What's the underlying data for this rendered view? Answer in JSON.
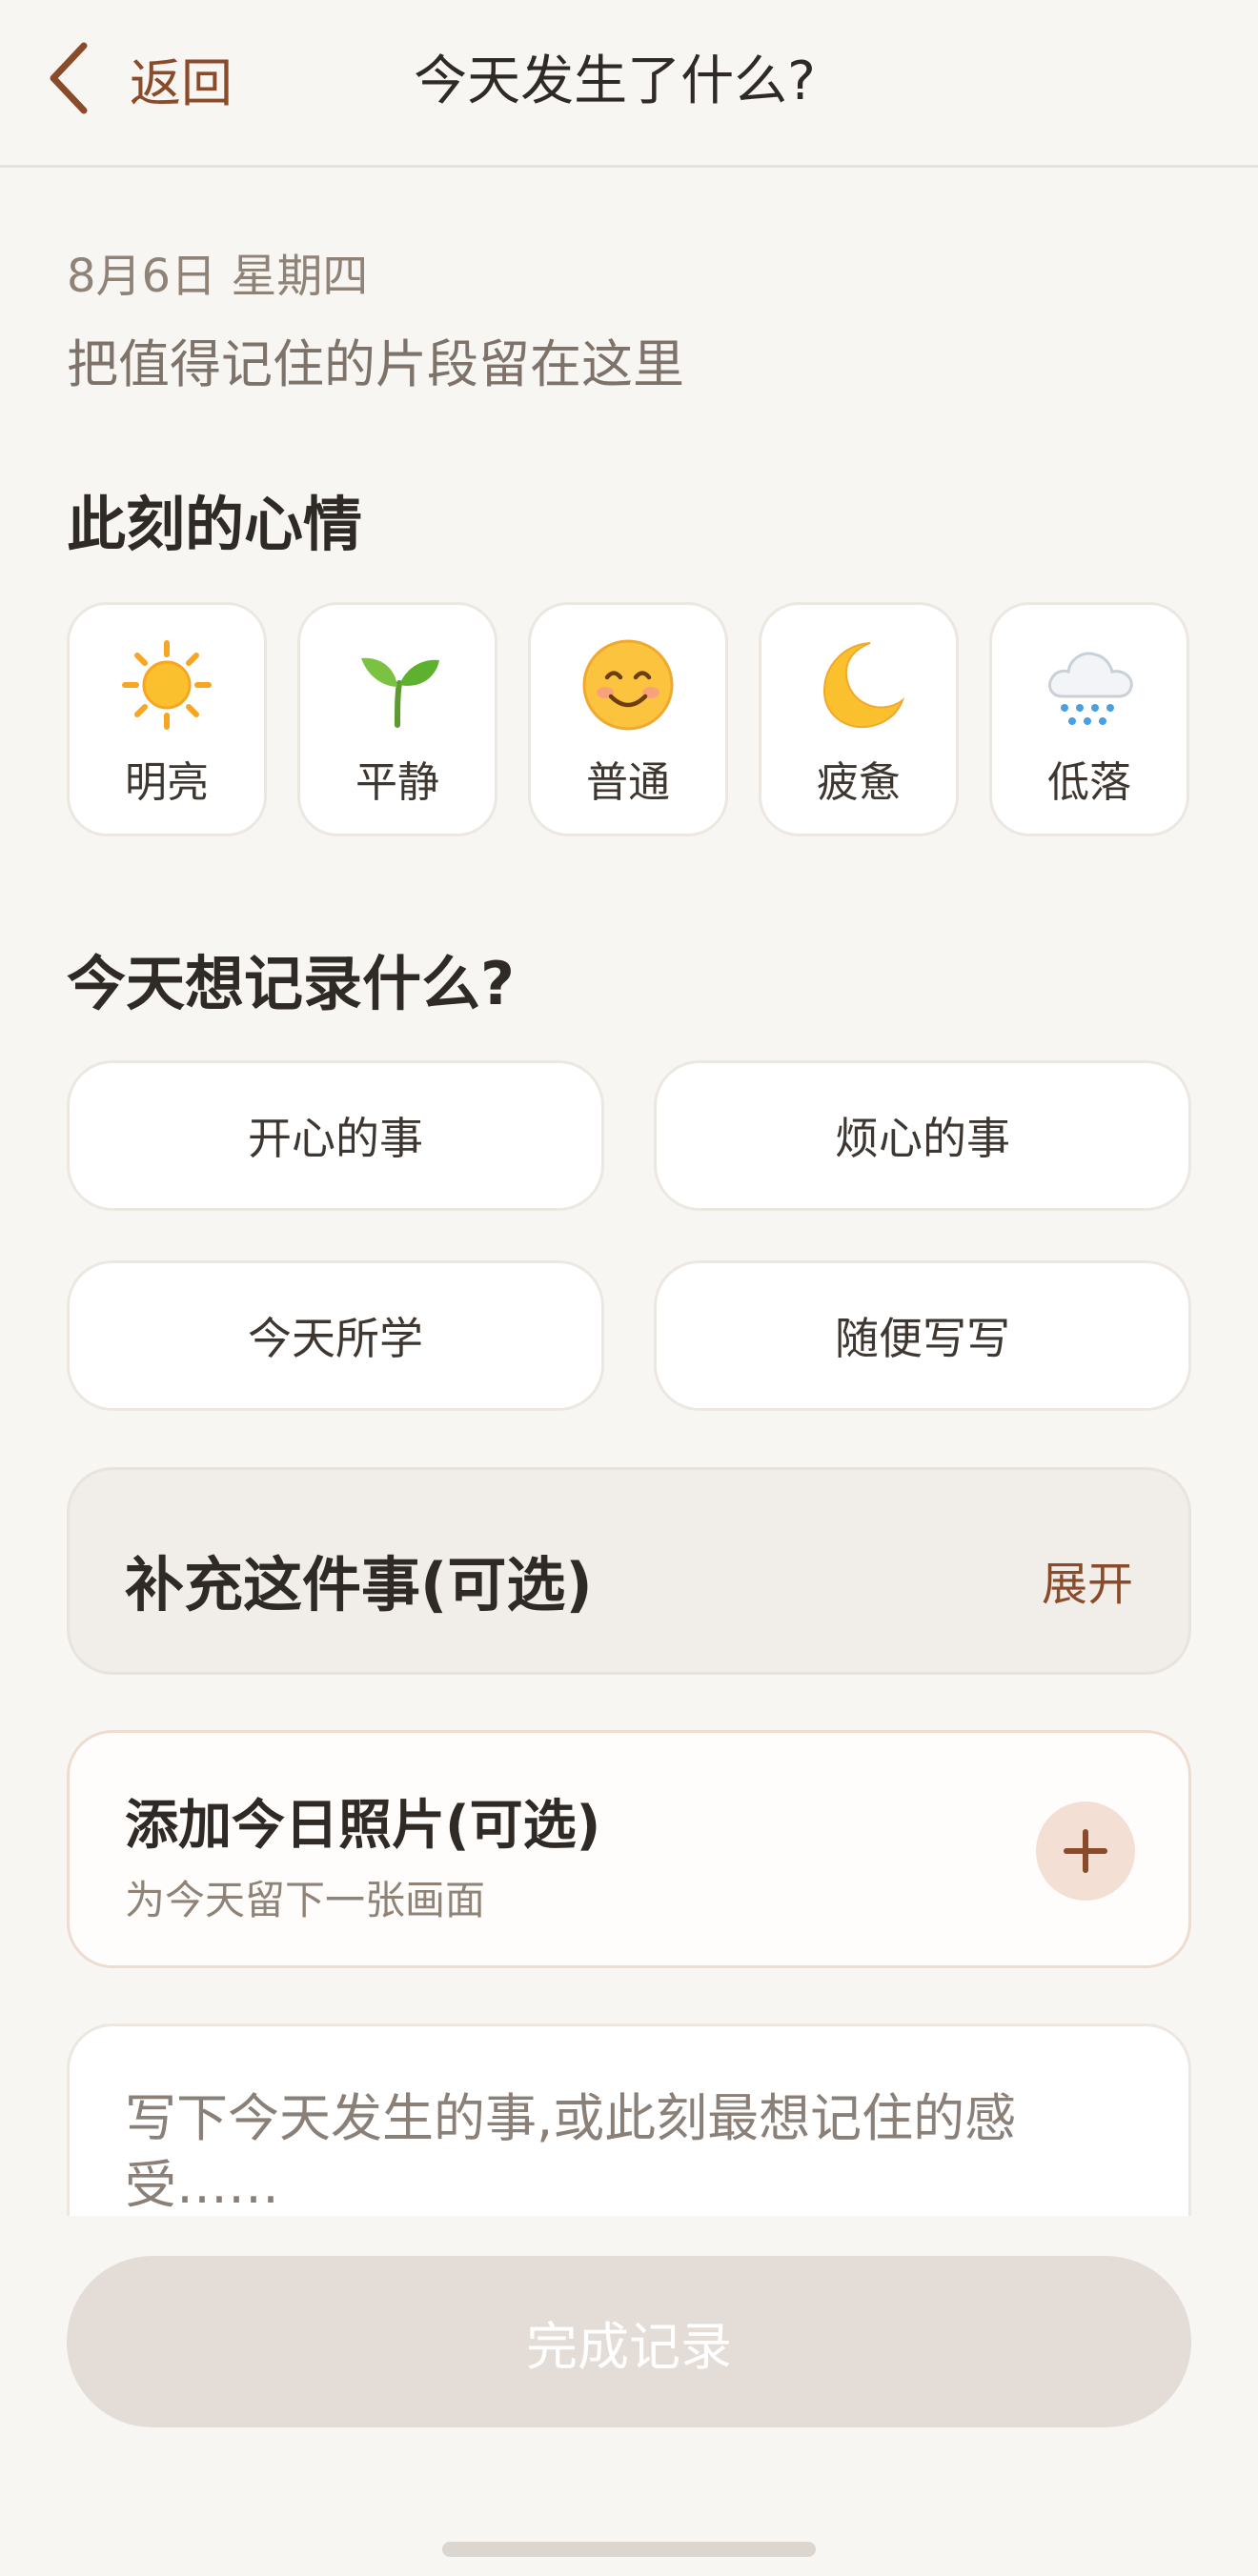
{
  "header": {
    "back_label": "返回",
    "title": "今天发生了什么?"
  },
  "intro": {
    "date": "8月6日 星期四",
    "subtitle": "把值得记住的片段留在这里"
  },
  "mood_section": {
    "title": "此刻的心情",
    "moods": [
      {
        "label": "明亮",
        "icon": "sun-icon"
      },
      {
        "label": "平静",
        "icon": "seedling-icon"
      },
      {
        "label": "普通",
        "icon": "smiling-face-icon"
      },
      {
        "label": "疲惫",
        "icon": "crescent-moon-icon"
      },
      {
        "label": "低落",
        "icon": "rain-cloud-icon"
      }
    ]
  },
  "record_section": {
    "title": "今天想记录什么?",
    "options": [
      "开心的事",
      "烦心的事",
      "今天所学",
      "随便写写"
    ]
  },
  "supplement": {
    "title": "补充这件事(可选)",
    "toggle": "展开"
  },
  "photo": {
    "title": "添加今日照片(可选)",
    "hint": "为今天留下一张画面",
    "add_icon": "plus-icon"
  },
  "note": {
    "placeholder": "写下今天发生的事,或此刻最想记住的感受……"
  },
  "submit": {
    "label": "完成记录"
  },
  "colors": {
    "accent": "#8a4b2b",
    "background": "#f8f6f3",
    "disabled_button": "#e4dcd6"
  }
}
